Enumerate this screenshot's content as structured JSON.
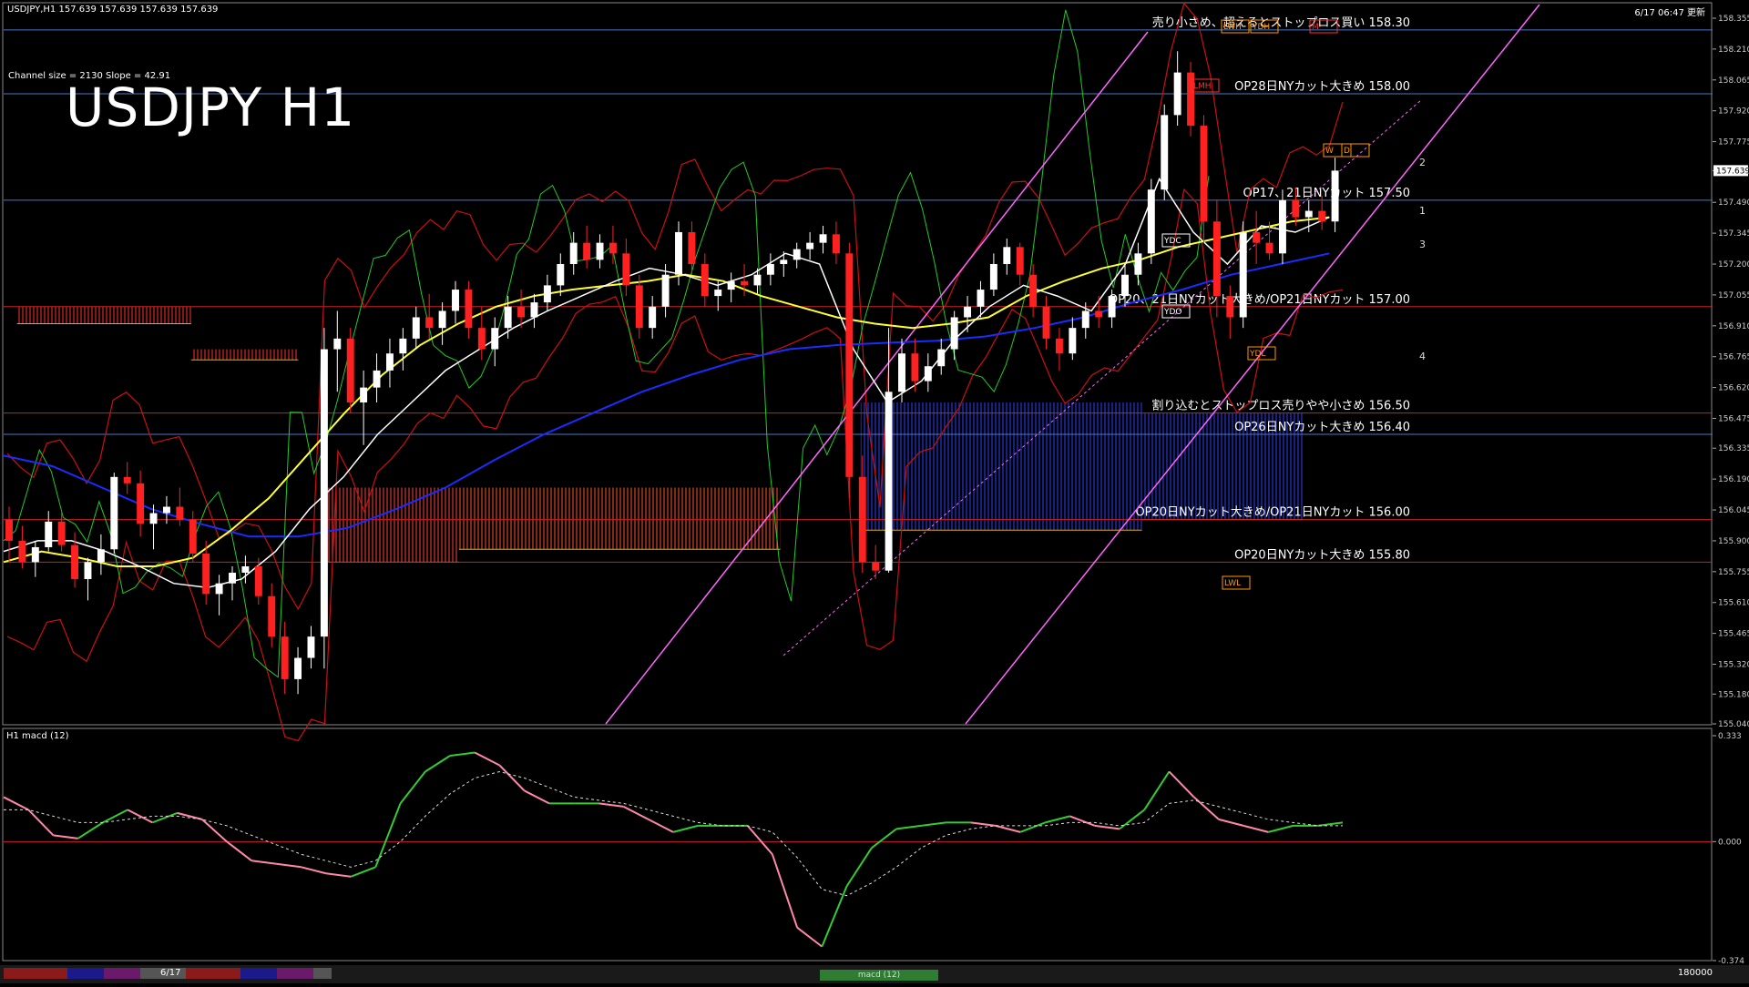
{
  "header": {
    "symbol_info": "USDJPY,H1  157.639 157.639 157.639 157.639",
    "timestamp": "6/17 06:47 更新",
    "channel_info": "Channel size = 2130 Slope = 42.91",
    "title": "USDJPY H1"
  },
  "indicator_label": "H1  macd (12)",
  "bottom_bar": {
    "date_label": "6/17",
    "tab_label": "macd (12)",
    "right_value": "180000"
  },
  "colors": {
    "background": "#000000",
    "bull": "#ffffff",
    "bear": "#ff2020",
    "ma_white": "#ffffff",
    "ma_yellow": "#ffff33",
    "ma_blue": "#1a2cff",
    "bollinger": "#cc1010",
    "chikou": "#22cc22",
    "channel": "#ff66ff",
    "macd": "#33cc33",
    "macd_neg": "#ff88aa",
    "signal": "#dddddd",
    "level_line": "#4a78c8",
    "red_line": "#cc2020"
  },
  "chart_data": {
    "type": "candlestick",
    "title": "USDJPY H1",
    "ylim": [
      155.04,
      158.355
    ],
    "y_ticks": [
      155.04,
      155.18,
      155.32,
      155.465,
      155.61,
      155.755,
      155.9,
      156.045,
      156.19,
      156.335,
      156.475,
      156.62,
      156.765,
      156.91,
      157.055,
      157.2,
      157.345,
      157.49,
      157.639,
      157.775,
      157.92,
      158.065,
      158.21,
      158.355
    ],
    "current_price": 157.639,
    "candles": [
      [
        156.0,
        156.06,
        155.8,
        155.9
      ],
      [
        155.9,
        155.97,
        155.77,
        155.8
      ],
      [
        155.8,
        155.9,
        155.73,
        155.87
      ],
      [
        155.87,
        156.04,
        155.85,
        155.99
      ],
      [
        155.99,
        156.04,
        155.85,
        155.88
      ],
      [
        155.88,
        155.94,
        155.68,
        155.72
      ],
      [
        155.72,
        155.82,
        155.62,
        155.8
      ],
      [
        155.8,
        155.93,
        155.74,
        155.86
      ],
      [
        155.86,
        156.22,
        155.84,
        156.2
      ],
      [
        156.2,
        156.27,
        156.12,
        156.17
      ],
      [
        156.17,
        156.23,
        155.92,
        155.98
      ],
      [
        155.98,
        156.07,
        155.86,
        156.03
      ],
      [
        156.03,
        156.11,
        155.98,
        156.06
      ],
      [
        156.06,
        156.15,
        155.97,
        156.0
      ],
      [
        156.0,
        156.04,
        155.8,
        155.84
      ],
      [
        155.84,
        155.9,
        155.6,
        155.65
      ],
      [
        155.65,
        155.74,
        155.55,
        155.7
      ],
      [
        155.7,
        155.78,
        155.62,
        155.75
      ],
      [
        155.75,
        155.83,
        155.7,
        155.78
      ],
      [
        155.78,
        155.82,
        155.6,
        155.64
      ],
      [
        155.64,
        155.7,
        155.4,
        155.45
      ],
      [
        155.45,
        155.52,
        155.18,
        155.25
      ],
      [
        155.25,
        155.4,
        155.18,
        155.35
      ],
      [
        155.35,
        155.5,
        155.3,
        155.45
      ],
      [
        155.45,
        156.9,
        155.3,
        156.8
      ],
      [
        156.8,
        156.98,
        156.6,
        156.85
      ],
      [
        156.85,
        156.9,
        156.5,
        156.55
      ],
      [
        156.55,
        156.7,
        156.35,
        156.62
      ],
      [
        156.62,
        156.78,
        156.55,
        156.7
      ],
      [
        156.7,
        156.85,
        156.62,
        156.78
      ],
      [
        156.78,
        156.9,
        156.7,
        156.85
      ],
      [
        156.85,
        157.0,
        156.8,
        156.95
      ],
      [
        156.95,
        157.06,
        156.85,
        156.9
      ],
      [
        156.9,
        157.02,
        156.82,
        156.98
      ],
      [
        156.98,
        157.12,
        156.92,
        157.08
      ],
      [
        157.08,
        157.12,
        156.85,
        156.9
      ],
      [
        156.9,
        157.0,
        156.75,
        156.8
      ],
      [
        156.8,
        156.95,
        156.72,
        156.9
      ],
      [
        156.9,
        157.05,
        156.85,
        157.0
      ],
      [
        157.0,
        157.08,
        156.9,
        156.95
      ],
      [
        156.95,
        157.06,
        156.9,
        157.02
      ],
      [
        157.02,
        157.15,
        156.98,
        157.1
      ],
      [
        157.1,
        157.25,
        157.05,
        157.2
      ],
      [
        157.2,
        157.35,
        157.15,
        157.3
      ],
      [
        157.3,
        157.38,
        157.18,
        157.22
      ],
      [
        157.22,
        157.34,
        157.18,
        157.3
      ],
      [
        157.3,
        157.38,
        157.2,
        157.25
      ],
      [
        157.25,
        157.32,
        157.05,
        157.1
      ],
      [
        157.1,
        157.15,
        156.85,
        156.9
      ],
      [
        156.9,
        157.05,
        156.85,
        157.0
      ],
      [
        157.0,
        157.2,
        156.95,
        157.15
      ],
      [
        157.15,
        157.4,
        157.1,
        157.35
      ],
      [
        157.35,
        157.4,
        157.15,
        157.2
      ],
      [
        157.2,
        157.25,
        157.0,
        157.05
      ],
      [
        157.05,
        157.12,
        156.98,
        157.08
      ],
      [
        157.08,
        157.16,
        157.02,
        157.12
      ],
      [
        157.12,
        157.2,
        157.05,
        157.1
      ],
      [
        157.1,
        157.18,
        157.06,
        157.15
      ],
      [
        157.15,
        157.25,
        157.1,
        157.2
      ],
      [
        157.2,
        157.26,
        157.14,
        157.22
      ],
      [
        157.22,
        157.3,
        157.18,
        157.27
      ],
      [
        157.27,
        157.35,
        157.22,
        157.3
      ],
      [
        157.3,
        157.38,
        157.25,
        157.34
      ],
      [
        157.34,
        157.4,
        157.2,
        157.25
      ],
      [
        157.25,
        157.3,
        156.1,
        156.2
      ],
      [
        156.2,
        156.3,
        155.75,
        155.8
      ],
      [
        155.8,
        155.88,
        155.72,
        155.76
      ],
      [
        155.76,
        156.9,
        155.75,
        156.6
      ],
      [
        156.6,
        156.85,
        156.55,
        156.78
      ],
      [
        156.78,
        156.85,
        156.6,
        156.65
      ],
      [
        156.65,
        156.78,
        156.6,
        156.72
      ],
      [
        156.72,
        156.85,
        156.68,
        156.8
      ],
      [
        156.8,
        156.98,
        156.75,
        156.95
      ],
      [
        156.95,
        157.05,
        156.88,
        157.0
      ],
      [
        157.0,
        157.12,
        156.95,
        157.08
      ],
      [
        157.08,
        157.25,
        157.05,
        157.2
      ],
      [
        157.2,
        157.32,
        157.15,
        157.28
      ],
      [
        157.28,
        157.3,
        157.1,
        157.15
      ],
      [
        157.15,
        157.2,
        156.95,
        157.0
      ],
      [
        157.0,
        157.05,
        156.8,
        156.85
      ],
      [
        156.85,
        156.9,
        156.7,
        156.78
      ],
      [
        156.78,
        156.95,
        156.75,
        156.9
      ],
      [
        156.9,
        157.02,
        156.85,
        156.98
      ],
      [
        156.98,
        157.05,
        156.9,
        156.95
      ],
      [
        156.95,
        157.08,
        156.9,
        157.05
      ],
      [
        157.05,
        157.2,
        157.0,
        157.15
      ],
      [
        157.15,
        157.3,
        157.1,
        157.25
      ],
      [
        157.25,
        157.6,
        157.2,
        157.55
      ],
      [
        157.55,
        157.95,
        157.5,
        157.9
      ],
      [
        157.9,
        158.2,
        157.85,
        158.1
      ],
      [
        158.1,
        158.15,
        157.8,
        157.85
      ],
      [
        157.85,
        157.9,
        157.3,
        157.4
      ],
      [
        157.4,
        157.5,
        156.95,
        157.05
      ],
      [
        157.05,
        157.1,
        156.85,
        156.95
      ],
      [
        156.95,
        157.4,
        156.9,
        157.35
      ],
      [
        157.35,
        157.45,
        157.2,
        157.3
      ],
      [
        157.3,
        157.4,
        157.22,
        157.25
      ],
      [
        157.25,
        157.55,
        157.2,
        157.5
      ],
      [
        157.5,
        157.56,
        157.38,
        157.42
      ],
      [
        157.42,
        157.5,
        157.35,
        157.45
      ],
      [
        157.45,
        157.52,
        157.36,
        157.4
      ],
      [
        157.4,
        157.7,
        157.35,
        157.639
      ]
    ],
    "ma_white": [
      155.85,
      155.9,
      155.9,
      155.85,
      155.78,
      155.7,
      155.68,
      155.72,
      155.85,
      156.05,
      156.2,
      156.4,
      156.55,
      156.7,
      156.8,
      156.9,
      156.98,
      157.05,
      157.12,
      157.18,
      157.15,
      157.1,
      157.15,
      157.25,
      157.2,
      156.8,
      156.55,
      156.65,
      156.85,
      157.0,
      157.1,
      157.05,
      156.98,
      157.2,
      157.6,
      157.35,
      157.2,
      157.38,
      157.35,
      157.42
    ],
    "ma_yellow": [
      155.8,
      155.85,
      155.82,
      155.78,
      155.78,
      155.82,
      155.95,
      156.1,
      156.3,
      156.5,
      156.68,
      156.82,
      156.92,
      157.0,
      157.05,
      157.08,
      157.1,
      157.12,
      157.15,
      157.12,
      157.05,
      157.0,
      156.95,
      156.92,
      156.9,
      156.92,
      156.95,
      157.05,
      157.12,
      157.18,
      157.22,
      157.28,
      157.32,
      157.36,
      157.4,
      157.42
    ],
    "ma_blue": [
      156.3,
      156.25,
      156.15,
      156.05,
      155.98,
      155.92,
      155.92,
      155.96,
      156.05,
      156.15,
      156.28,
      156.4,
      156.5,
      156.6,
      156.68,
      156.75,
      156.8,
      156.82,
      156.83,
      156.84,
      156.86,
      156.9,
      156.95,
      157.02,
      157.08,
      157.15,
      157.2,
      157.25
    ],
    "cloud": [
      {
        "from": 0.01,
        "to": 0.14,
        "top": 157.0,
        "bottom": 156.92,
        "color": "#ff3030"
      },
      {
        "from": 0.14,
        "to": 0.22,
        "top": 156.8,
        "bottom": 156.75,
        "color": "#ff3030"
      },
      {
        "from": 0.24,
        "to": 0.34,
        "top": 156.15,
        "bottom": 155.8,
        "color": "#ff4040"
      },
      {
        "from": 0.34,
        "to": 0.58,
        "top": 156.15,
        "bottom": 155.86,
        "color": "#ff5030"
      },
      {
        "from": 0.64,
        "to": 0.85,
        "top": 156.55,
        "bottom": 155.95,
        "color": "#3040ff"
      },
      {
        "from": 0.85,
        "to": 0.97,
        "top": 156.5,
        "bottom": 156.0,
        "color": "#3040ff"
      }
    ],
    "levels": [
      {
        "value": 158.3,
        "label": "売り小さめ、超えるとストップロス買い 158.30",
        "color": "#4a78c8"
      },
      {
        "value": 158.0,
        "label": "OP28日NYカット大きめ 158.00",
        "color": "#4a78c8"
      },
      {
        "value": 157.5,
        "label": "OP17、21日NYカット 157.50",
        "color": "#4a78c8"
      },
      {
        "value": 157.0,
        "label": "OP20、21日NYカット大きめ/OP21日NYカット 157.00",
        "color": "#cc2020"
      },
      {
        "value": 156.5,
        "label": "割り込むとストップロス売りやや小さめ 156.50",
        "color": "#cc2020"
      },
      {
        "value": 156.4,
        "label": "OP26日NYカット大きめ 156.40",
        "color": "#4a78c8"
      },
      {
        "value": 156.0,
        "label": "OP20日NYカット大きめ/OP21日NYカット 156.00",
        "color": "#cc2020"
      },
      {
        "value": 155.8,
        "label": "OP20日NYカット大きめ 155.80",
        "color": "#cc2020"
      }
    ],
    "tags": [
      {
        "label": "LWH",
        "color": "#ff9900"
      },
      {
        "label": "YDH",
        "color": "#ff9900"
      },
      {
        "label": "M",
        "color": "#ff3030"
      },
      {
        "label": "LMH",
        "color": "#ff3030"
      },
      {
        "label": "W",
        "color": "#ff9900"
      },
      {
        "label": "D",
        "color": "#ff9900"
      },
      {
        "label": "YDC",
        "color": "#ffffff"
      },
      {
        "label": "YDO",
        "color": "#ffffff"
      },
      {
        "label": "YDL",
        "color": "#ff9900"
      },
      {
        "label": "LWL",
        "color": "#ff9900"
      }
    ],
    "channel_labels": [
      "1",
      "2",
      "3",
      "4"
    ],
    "macd": {
      "label": "H1  macd (12)",
      "ylim": [
        -0.374,
        0.333
      ],
      "ticks": [
        0.333,
        0.0,
        -0.374
      ],
      "values": [
        0.14,
        0.1,
        0.02,
        0.01,
        0.06,
        0.1,
        0.06,
        0.09,
        0.07,
        0.0,
        -0.06,
        -0.07,
        -0.08,
        -0.1,
        -0.11,
        -0.08,
        0.12,
        0.22,
        0.27,
        0.28,
        0.24,
        0.16,
        0.12,
        0.12,
        0.12,
        0.11,
        0.07,
        0.03,
        0.05,
        0.05,
        0.05,
        -0.04,
        -0.27,
        -0.33,
        -0.14,
        -0.02,
        0.04,
        0.05,
        0.06,
        0.06,
        0.05,
        0.03,
        0.06,
        0.08,
        0.05,
        0.04,
        0.1,
        0.22,
        0.14,
        0.07,
        0.05,
        0.03,
        0.05,
        0.05,
        0.06
      ],
      "signal": [
        0.1,
        0.1,
        0.08,
        0.06,
        0.06,
        0.07,
        0.08,
        0.08,
        0.07,
        0.05,
        0.02,
        -0.01,
        -0.04,
        -0.06,
        -0.08,
        -0.06,
        0.0,
        0.08,
        0.15,
        0.2,
        0.22,
        0.2,
        0.17,
        0.14,
        0.13,
        0.12,
        0.1,
        0.08,
        0.06,
        0.05,
        0.05,
        0.03,
        -0.05,
        -0.15,
        -0.17,
        -0.13,
        -0.08,
        -0.02,
        0.02,
        0.04,
        0.05,
        0.05,
        0.05,
        0.06,
        0.06,
        0.05,
        0.06,
        0.12,
        0.13,
        0.11,
        0.09,
        0.07,
        0.06,
        0.05,
        0.05
      ]
    }
  }
}
